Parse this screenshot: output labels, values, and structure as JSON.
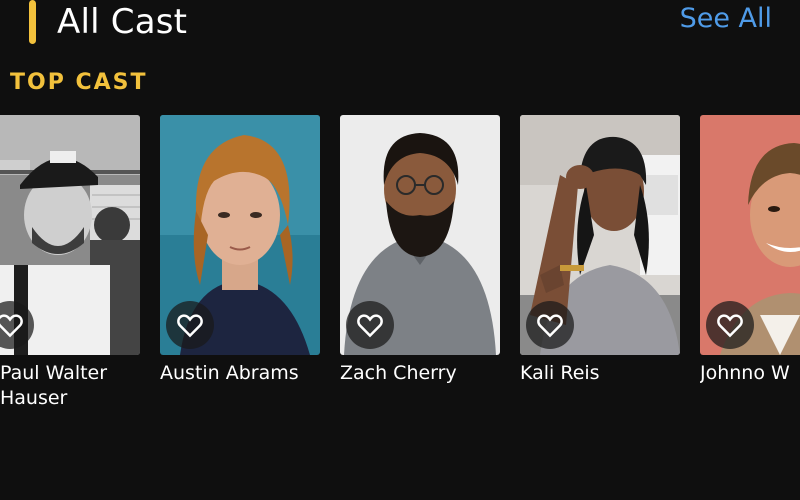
{
  "header": {
    "title": "All Cast",
    "see_all_label": "See All",
    "accent_color": "#f2c13c",
    "link_color": "#4f9be8"
  },
  "section": {
    "title": "TOP CAST"
  },
  "cast": [
    {
      "name": "Paul Walter Hauser",
      "photo_style": "black-and-white",
      "icon": "heart-outline-icon"
    },
    {
      "name": "Austin Abrams",
      "photo_style": "teal-background",
      "icon": "heart-outline-icon"
    },
    {
      "name": "Zach Cherry",
      "photo_style": "light-gray-background",
      "icon": "heart-outline-icon"
    },
    {
      "name": "Kali Reis",
      "photo_style": "kitchen-background",
      "icon": "heart-outline-icon"
    },
    {
      "name": "Johnno W",
      "photo_style": "coral-background",
      "icon": "heart-outline-icon"
    }
  ]
}
